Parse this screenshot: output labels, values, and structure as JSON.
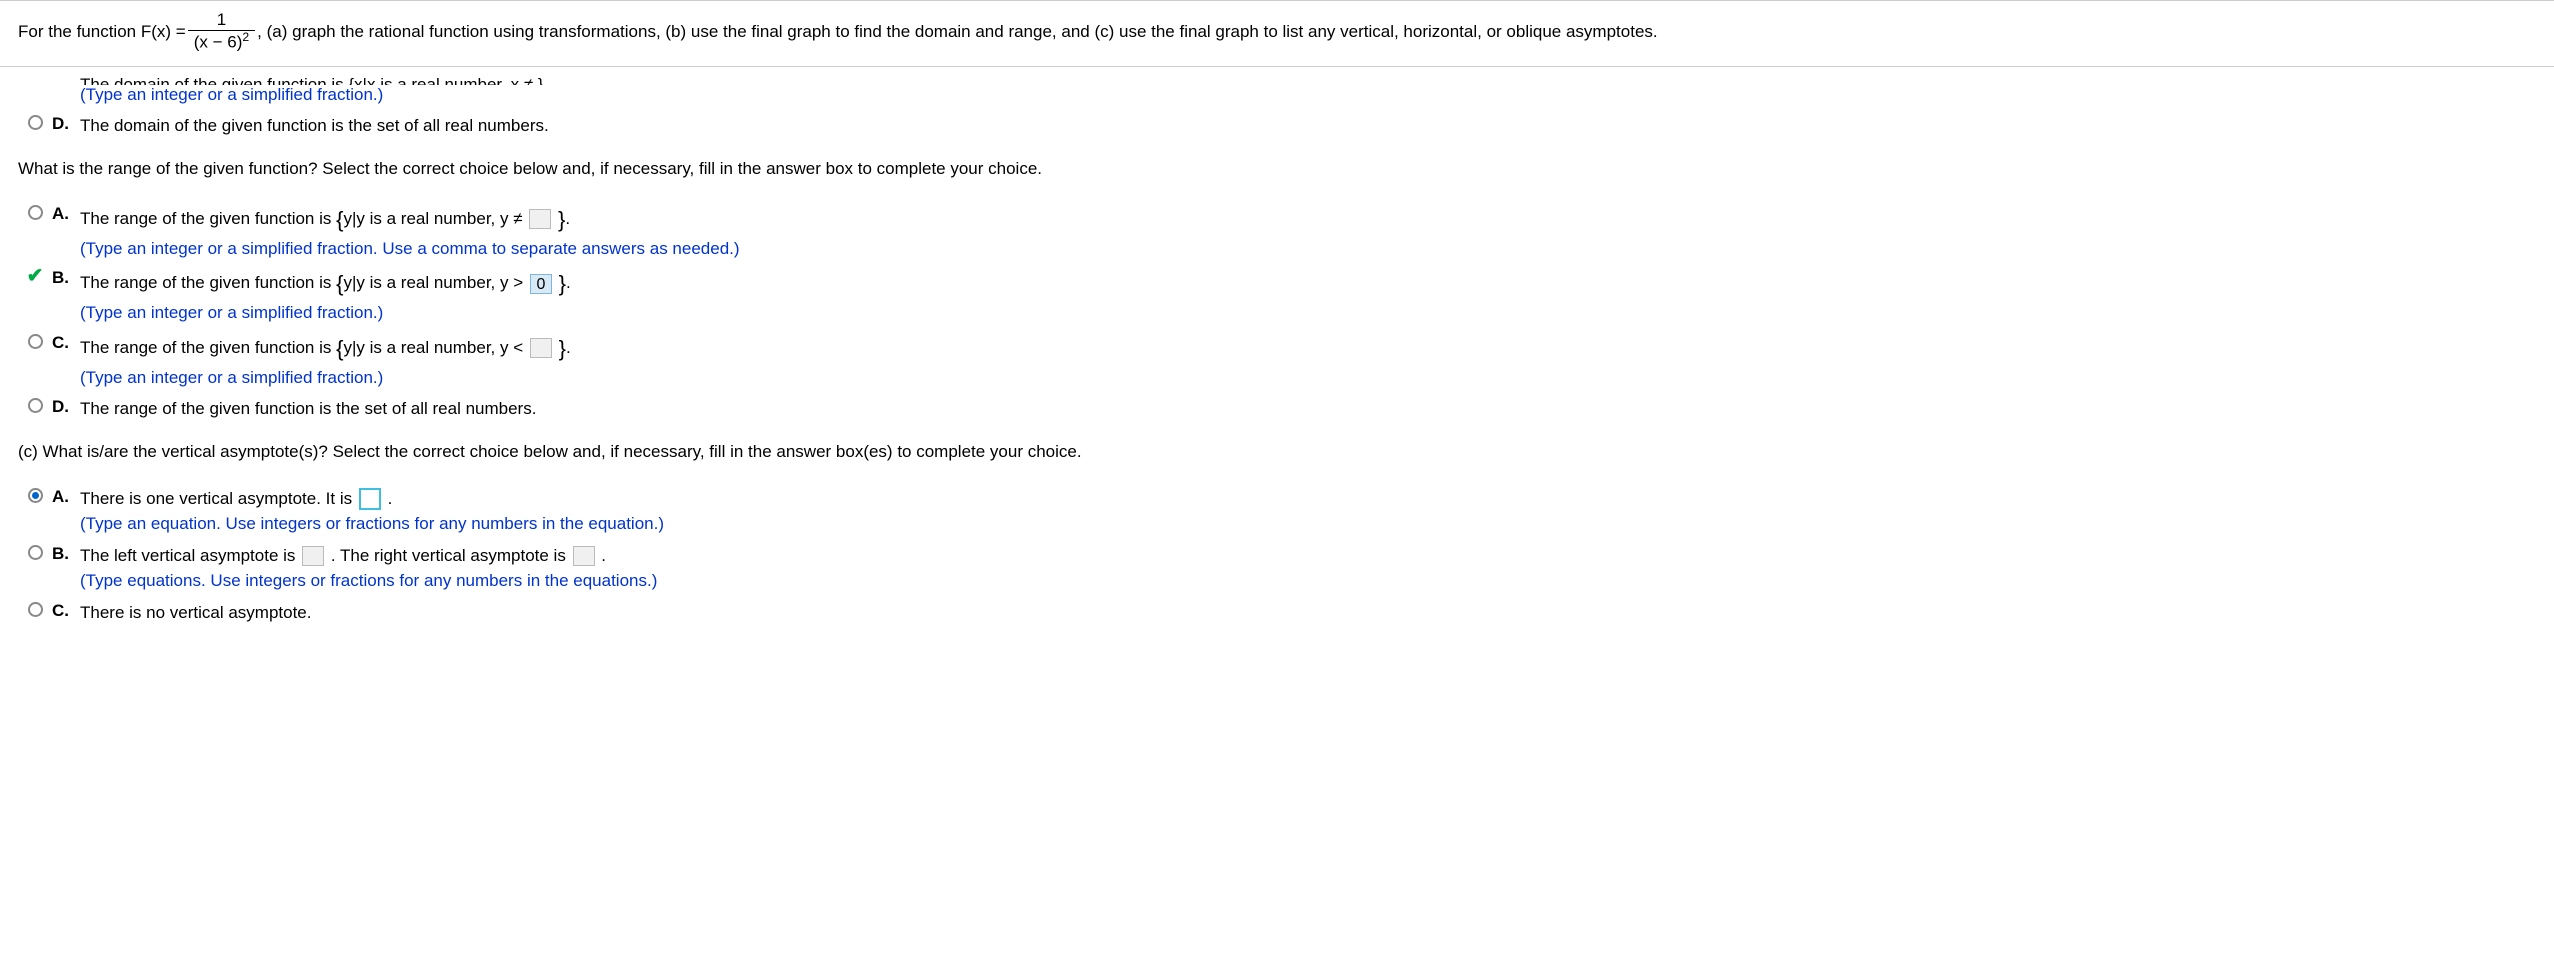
{
  "header": {
    "prefix": "For the function F(x) =",
    "numerator": "1",
    "denominator_left": "(x − 6)",
    "denominator_exp": "2",
    "suffix": ", (a) graph the rational function using transformations, (b) use the final graph to find the domain and range, and (c) use the final graph to list any vertical, horizontal, or oblique asymptotes."
  },
  "partial_top_text": "The domain of the given function is {x|x is a real number, x ≠    } .",
  "partial_hint": "(Type an integer or a simplified fraction.)",
  "domain_d": {
    "letter": "D.",
    "text": "The domain of the given function is the set of all real numbers."
  },
  "range_prompt": "What is the range of the given function? Select the correct choice below and, if necessary, fill in the answer box to complete your choice.",
  "range": {
    "a": {
      "letter": "A.",
      "pre": "The range of the given function is ",
      "set_open": "{",
      "set_body": "y|y is a real number, y ≠",
      "set_close": "}",
      "dot": ".",
      "hint": "(Type an integer or a simplified fraction. Use a comma to separate answers as needed.)"
    },
    "b": {
      "letter": "B.",
      "pre": "The range of the given function is ",
      "set_open": "{",
      "set_body": "y|y is a real number, y >",
      "value": "0",
      "set_close": "}",
      "dot": ".",
      "hint": "(Type an integer or a simplified fraction.)"
    },
    "c": {
      "letter": "C.",
      "pre": "The range of the given function is ",
      "set_open": "{",
      "set_body": "y|y is a real number, y <",
      "set_close": "}",
      "dot": ".",
      "hint": "(Type an integer or a simplified fraction.)"
    },
    "d": {
      "letter": "D.",
      "text": "The range of the given function is the set of all real numbers."
    }
  },
  "va_prompt": "(c) What is/are the vertical asymptote(s)? Select the correct choice below and, if necessary, fill in the answer box(es) to complete your choice.",
  "va": {
    "a": {
      "letter": "A.",
      "pre": "There is one vertical asymptote. It is ",
      "dot": ".",
      "hint": "(Type an equation. Use integers or fractions for any numbers in the equation.)"
    },
    "b": {
      "letter": "B.",
      "pre": "The left vertical asymptote is ",
      "mid": ". The right vertical asymptote is ",
      "dot": ".",
      "hint": "(Type equations. Use integers or fractions for any numbers in the equations.)"
    },
    "c": {
      "letter": "C.",
      "text": "There is no vertical asymptote."
    }
  }
}
